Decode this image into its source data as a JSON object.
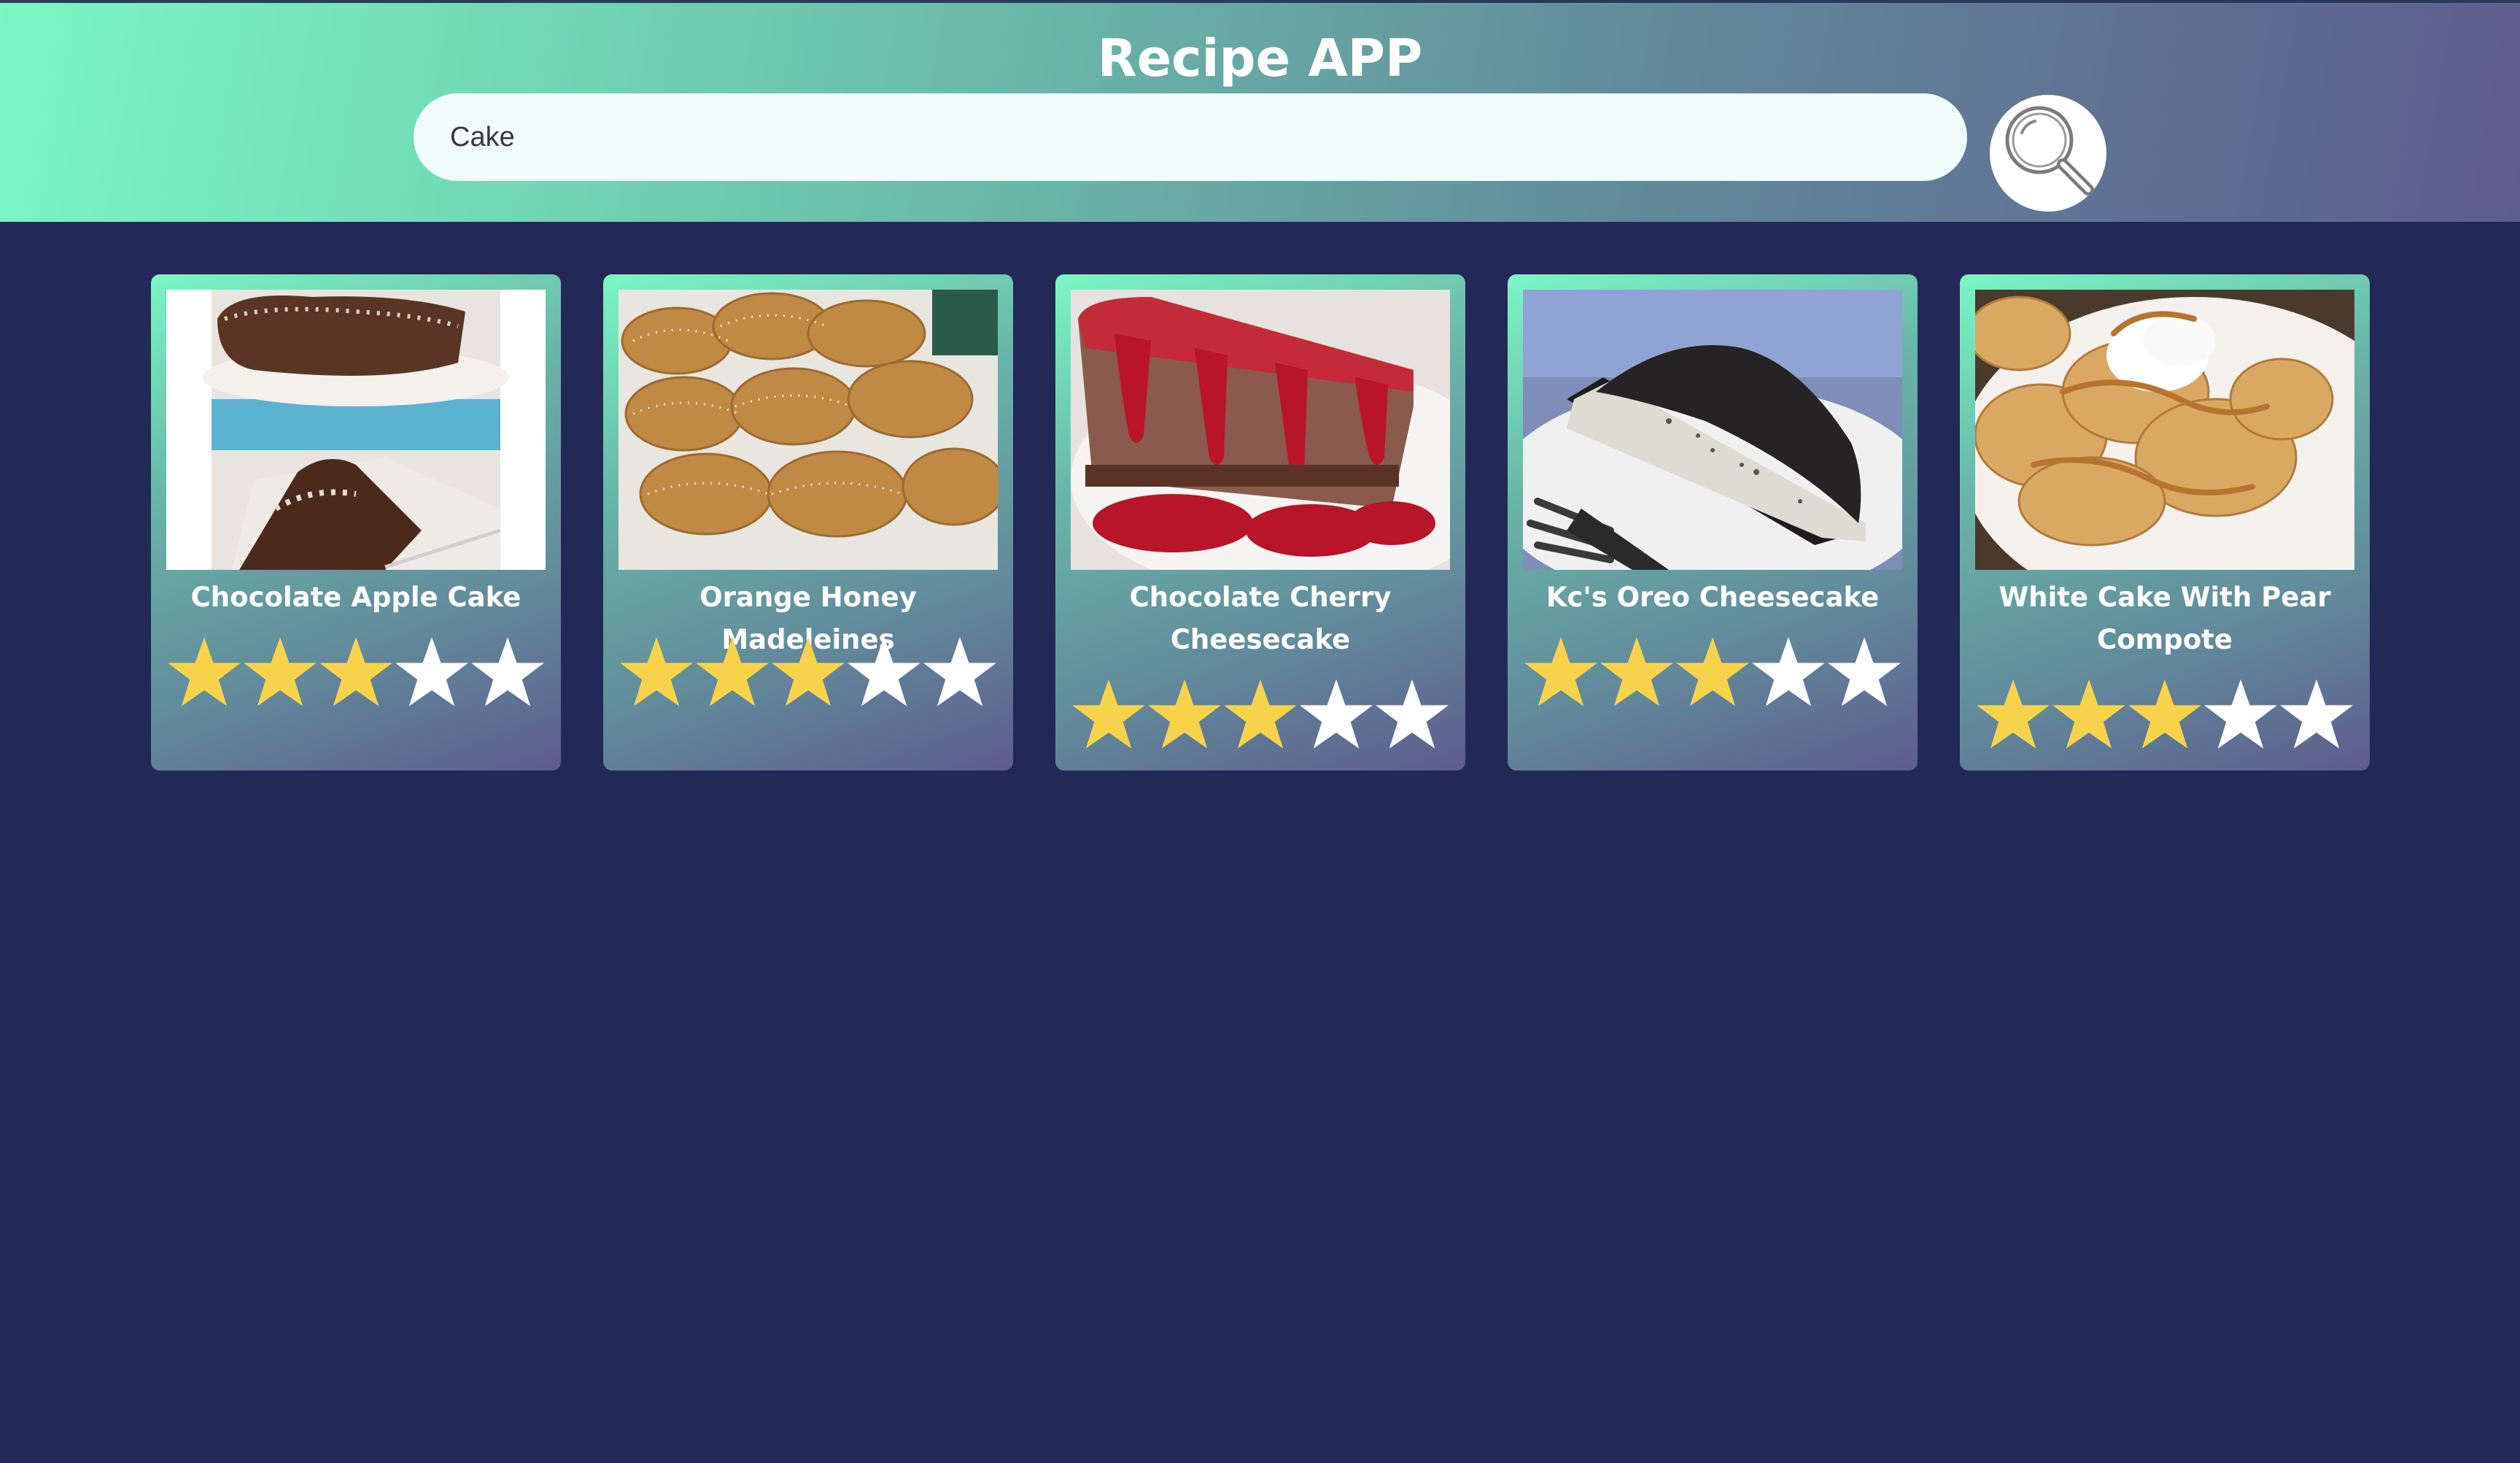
{
  "header": {
    "title": "Recipe APP"
  },
  "search": {
    "value": "Cake",
    "placeholder": ""
  },
  "icons": {
    "search": "magnifier-icon",
    "star_filled": "star-filled-icon",
    "star_empty": "star-empty-icon"
  },
  "colors": {
    "background": "#222956",
    "header_gradient_start": "#7af7c4",
    "header_gradient_end": "#5d5c8e",
    "star_filled": "#f7d34c",
    "star_empty": "#ffffff"
  },
  "recipes": [
    {
      "title": "Chocolate Apple Cake",
      "rating": 3,
      "max_rating": 5
    },
    {
      "title": "Orange Honey Madeleines",
      "rating": 3,
      "max_rating": 5
    },
    {
      "title": "Chocolate Cherry Cheesecake",
      "rating": 3,
      "max_rating": 5
    },
    {
      "title": "Kc's Oreo Cheesecake",
      "rating": 3,
      "max_rating": 5
    },
    {
      "title": "White Cake With Pear Compote",
      "rating": 3,
      "max_rating": 5
    }
  ]
}
